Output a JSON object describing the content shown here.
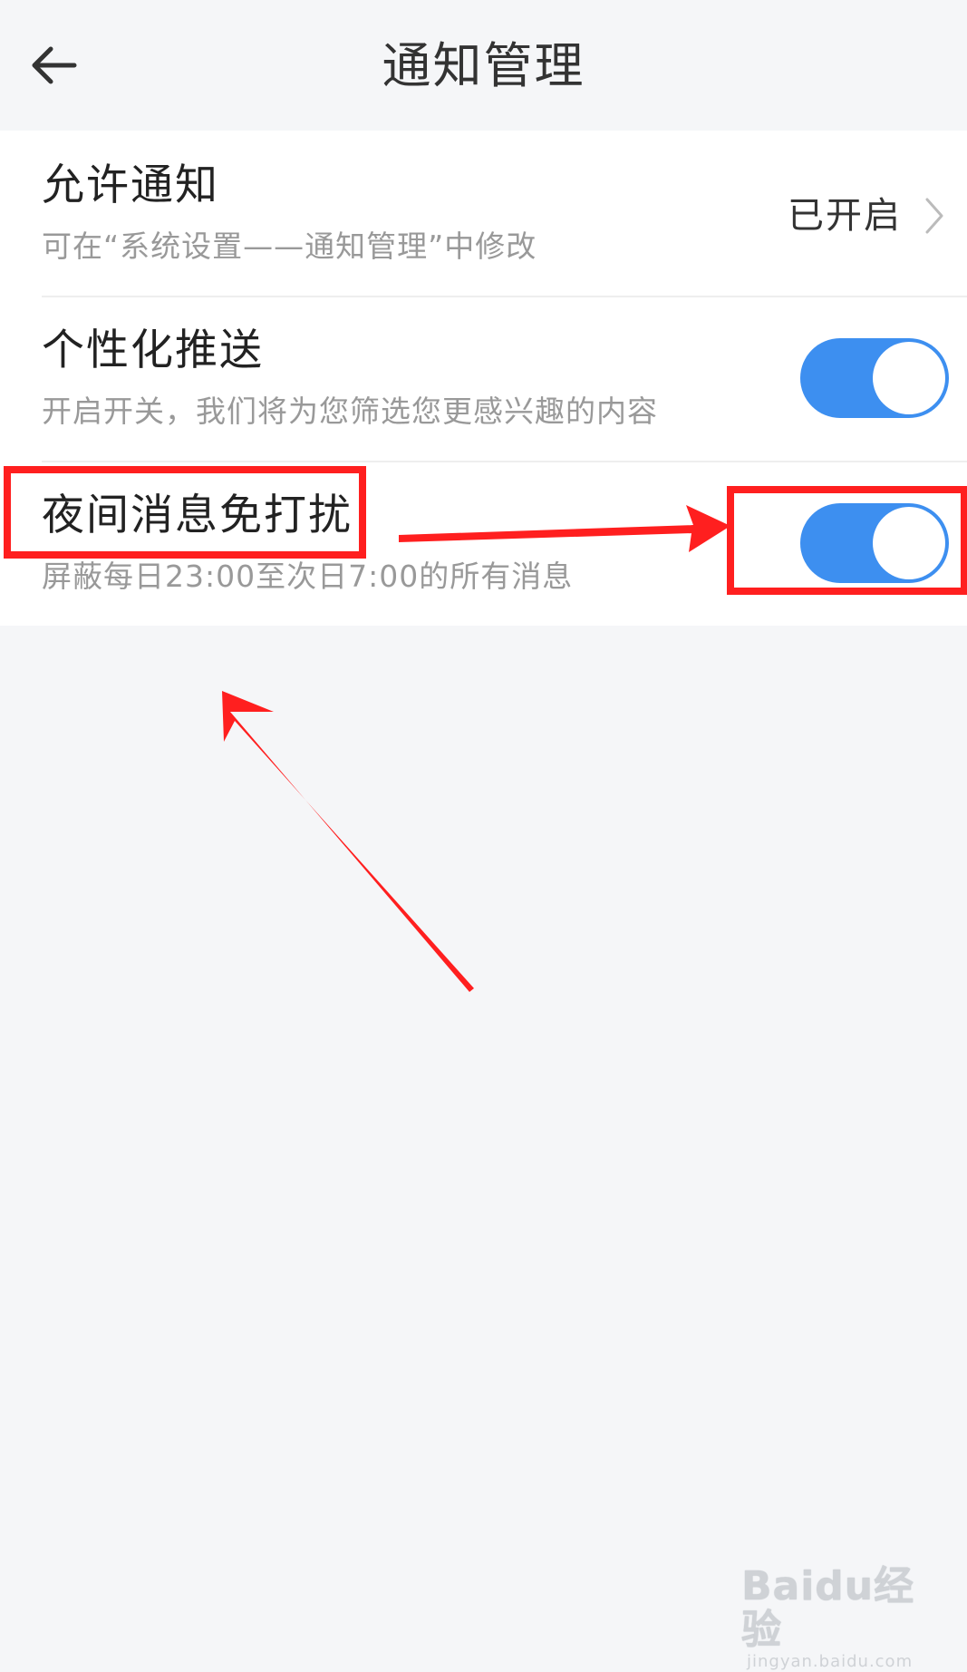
{
  "header": {
    "title": "通知管理",
    "back_icon": "arrow-left-icon"
  },
  "settings": {
    "allow_notifications": {
      "title": "允许通知",
      "description": "可在“系统设置——通知管理”中修改",
      "status": "已开启",
      "icon": "chevron-right-icon"
    },
    "personalized_push": {
      "title": "个性化推送",
      "description": "开启开关，我们将为您筛选您更感兴趣的内容",
      "enabled": true
    },
    "night_dnd": {
      "title": "夜间消息免打扰",
      "description": "屏蔽每日23:00至次日7:00的所有消息",
      "enabled": true
    }
  },
  "colors": {
    "toggle_on": "#3d8ff0",
    "background": "#f5f6f8",
    "annotation": "#ff1f1f"
  },
  "watermark": {
    "logo": "Baidu经验",
    "url": "jingyan.baidu.com"
  }
}
